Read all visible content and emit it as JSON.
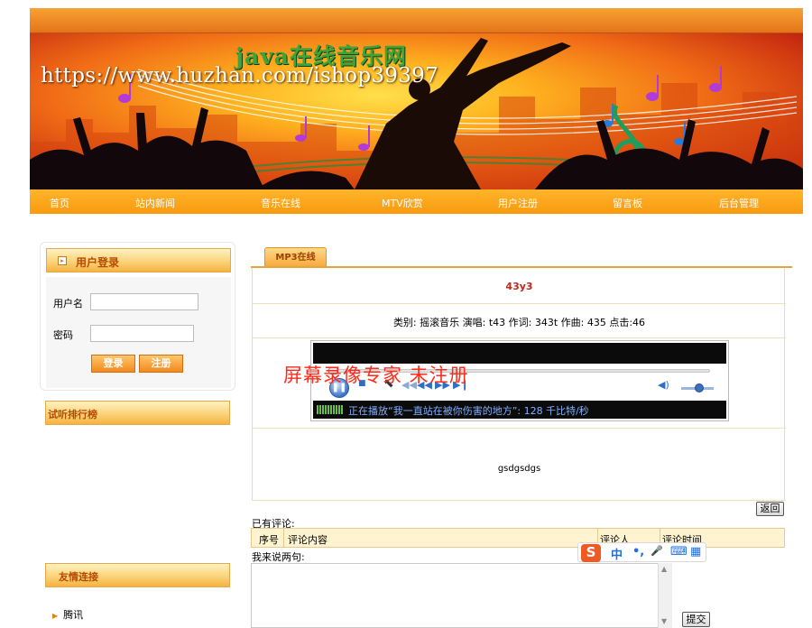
{
  "header": {
    "title": "java在线音乐网",
    "watermark_url": "https://www.huzhan.com/ishop39397",
    "nav": [
      "首页",
      "站内新闻",
      "音乐在线",
      "MTV欣赏",
      "用户注册",
      "留言板",
      "后台管理"
    ]
  },
  "login": {
    "title": "用户登录",
    "username_label": "用户名",
    "password_label": "密码",
    "login_button": "登录",
    "register_button": "注册"
  },
  "ranking": {
    "title": "试听排行榜"
  },
  "friends": {
    "title": "友情连接",
    "items": [
      "腾讯"
    ]
  },
  "main": {
    "tab": "MP3在线",
    "song_title": "43y3",
    "song_info": "类别: 摇滚音乐 演唱: t43 作词: 343t 作曲: 435 点击:46",
    "recorder_watermark": "屏幕录像专家 未注册",
    "player_status": "正在播放“我一直站在被你伤害的地方”: 128 千比特/秒",
    "song_body": "gsdgsdgs",
    "back_button": "返回",
    "comments_label": "已有评论:",
    "comment_columns": [
      "序号",
      "评论内容",
      "评论人",
      "评论时间"
    ],
    "say_label": "我来说两句:",
    "submit_button": "提交"
  },
  "ime": {
    "logo": "S",
    "items": [
      "中",
      "•,",
      "🎤",
      "⌨",
      "▦"
    ]
  },
  "colors": {
    "accent": "#f99a10",
    "title_red": "#c0281a",
    "header_orange": "#e5741a"
  }
}
